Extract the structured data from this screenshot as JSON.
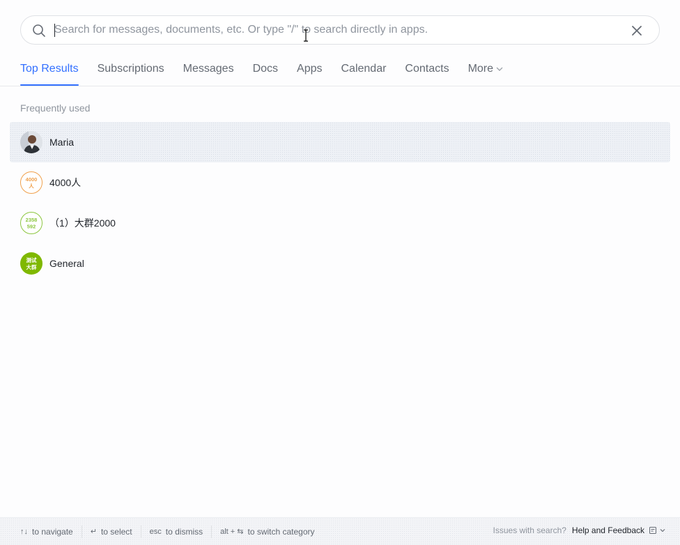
{
  "search": {
    "placeholder": "Search for messages, documents, etc. Or type \"/\" to search directly in apps.",
    "value": ""
  },
  "tabs": [
    {
      "label": "Top Results",
      "active": true
    },
    {
      "label": "Subscriptions"
    },
    {
      "label": "Messages"
    },
    {
      "label": "Docs"
    },
    {
      "label": "Apps"
    },
    {
      "label": "Calendar"
    },
    {
      "label": "Contacts"
    },
    {
      "label": "More"
    }
  ],
  "section_title": "Frequently used",
  "items": [
    {
      "label": "Maria",
      "avatar": "photo"
    },
    {
      "label": "4000人",
      "avatar_text": [
        "4000",
        "人"
      ],
      "color": "#f0a04b"
    },
    {
      "label": "（1）大群2000",
      "avatar_text": [
        "2358",
        "592"
      ],
      "color": "#8cc63f"
    },
    {
      "label": "General",
      "avatar_text": [
        "测试",
        "大群"
      ],
      "color": "#7fb800"
    }
  ],
  "footer": {
    "navigate": "to navigate",
    "navigate_key": "↑↓",
    "select": "to select",
    "select_key": "↵",
    "dismiss": "to dismiss",
    "dismiss_key": "esc",
    "switch": "to switch category",
    "switch_key": "alt + ⇆",
    "issues": "Issues with search?",
    "feedback": "Help and Feedback"
  },
  "colors": {
    "accent": "#3370ff",
    "hover_row": "#eef1f6"
  }
}
